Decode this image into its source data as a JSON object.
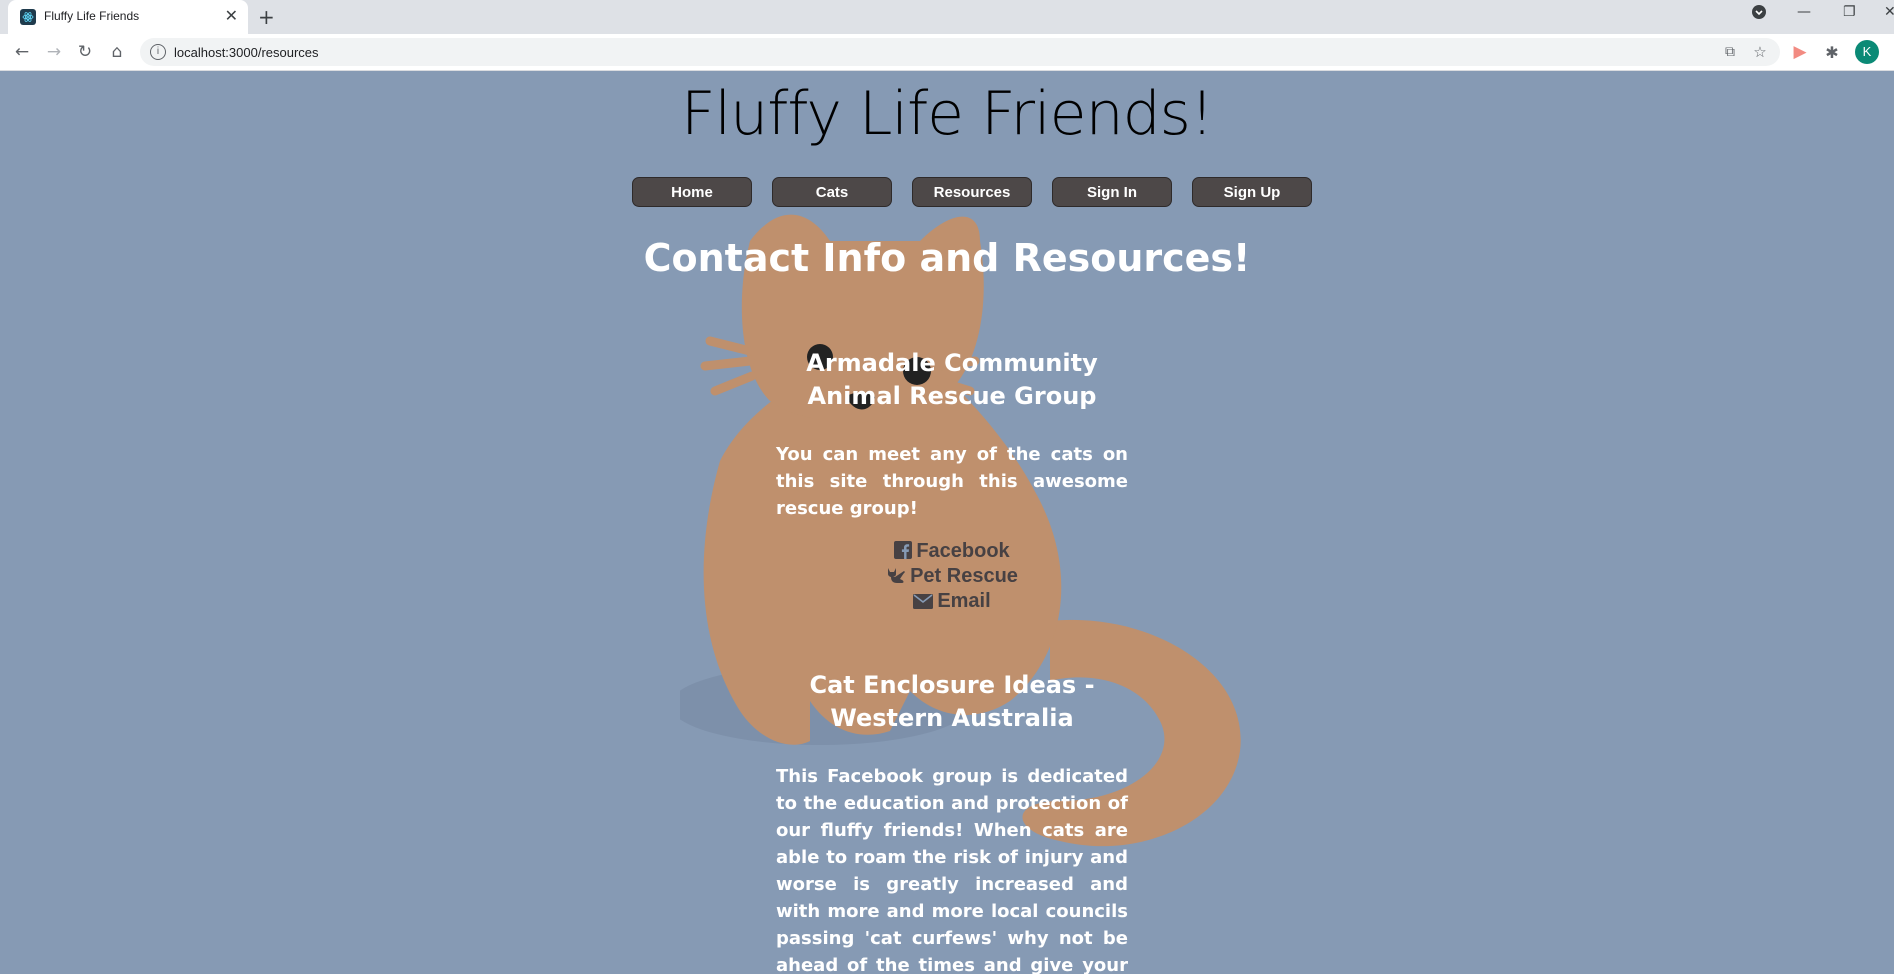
{
  "browser": {
    "tab_title": "Fluffy Life Friends",
    "url": "localhost:3000/resources",
    "profile_initial": "K"
  },
  "site": {
    "title": "Fluffy Life Friends!",
    "nav": [
      "Home",
      "Cats",
      "Resources",
      "Sign In",
      "Sign Up"
    ]
  },
  "page": {
    "heading": "Contact Info and Resources!",
    "sections": [
      {
        "title": "Armadale Community Animal Rescue Group",
        "description": "You can meet any of the cats on this site through this awesome rescue group!",
        "links": [
          {
            "icon": "facebook-icon",
            "label": "Facebook"
          },
          {
            "icon": "cat-icon",
            "label": "Pet Rescue"
          },
          {
            "icon": "envelope-icon",
            "label": "Email"
          }
        ]
      },
      {
        "title": "Cat Enclosure Ideas - Western Australia",
        "description": "This Facebook group is dedicated to the education and protection of our fluffy friends! When cats are able to roam the risk of injury and worse is greatly increased and with more and more local councils passing 'cat curfews' why not be ahead of the times and give your fluffy family"
      }
    ]
  },
  "colors": {
    "page_bg": "#869ab4",
    "nav_button_bg": "#4d4848",
    "cat_fill": "#bf906d",
    "link_color": "#474143"
  }
}
